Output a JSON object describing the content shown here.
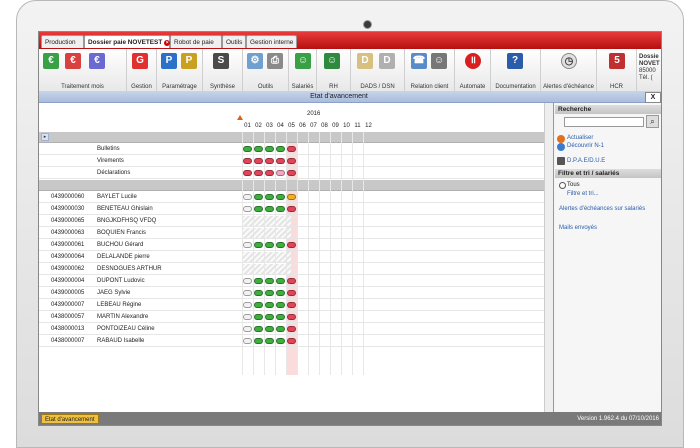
{
  "tabs": [
    {
      "label": "Production",
      "active": false,
      "closable": false
    },
    {
      "label": "Dossier paie NOVETEST",
      "active": true,
      "closable": true
    },
    {
      "label": "Robot de paie",
      "active": false,
      "closable": false
    },
    {
      "label": "Outils",
      "active": false,
      "closable": false
    },
    {
      "label": "Gestion interne",
      "active": false,
      "closable": false
    }
  ],
  "ribbon": {
    "groups": [
      {
        "label": "Traitement mois",
        "icon": "payroll-month-icon"
      },
      {
        "label": "Gestion",
        "icon": "g-management-icon"
      },
      {
        "label": "Paramétrage",
        "icon": "parameter-icon"
      },
      {
        "label": "Synthèse",
        "icon": "synthesis-icon"
      },
      {
        "label": "Outils",
        "icon": "tools-icon"
      },
      {
        "label": "Salariés",
        "icon": "employees-icon"
      },
      {
        "label": "RH",
        "icon": "hr-icon"
      },
      {
        "label": "DADS / DSN",
        "icon": "dads-dsn-icon"
      },
      {
        "label": "Relation client",
        "icon": "client-relation-icon"
      },
      {
        "label": "Automate",
        "icon": "pause-icon"
      },
      {
        "label": "Documentation",
        "icon": "question-icon"
      },
      {
        "label": "Alertes d'échéance",
        "icon": "clock-icon"
      },
      {
        "label": "HCR",
        "icon": "hcr-icon"
      }
    ],
    "dossier_lines": [
      "Dossie",
      "NOVET",
      "85000",
      "Tél. ("
    ]
  },
  "window_title": "Etat d'avancement",
  "close_label": "X",
  "grid": {
    "year": "2016",
    "months": [
      "01",
      "02",
      "03",
      "04",
      "05",
      "06",
      "07",
      "08",
      "09",
      "10",
      "11",
      "12"
    ],
    "current_month_index": 4,
    "rows": [
      {
        "type": "grey",
        "code": "",
        "name": "",
        "selector": "▸"
      },
      {
        "type": "item",
        "code": "",
        "name": "Bulletins",
        "status": [
          "g",
          "g",
          "g",
          "g",
          "r"
        ]
      },
      {
        "type": "item",
        "code": "",
        "name": "Virements",
        "status": [
          "r",
          "r",
          "r",
          "r",
          "r"
        ]
      },
      {
        "type": "item",
        "code": "",
        "name": "Déclarations",
        "status": [
          "r",
          "r",
          "r",
          "k",
          "r"
        ]
      },
      {
        "type": "grey",
        "code": "",
        "name": ""
      },
      {
        "type": "emp",
        "code": "0439000060",
        "name": "BAYLET Lucile",
        "status": [
          "e",
          "g",
          "g",
          "g",
          "o"
        ]
      },
      {
        "type": "emp",
        "code": "0439000030",
        "name": "BENETEAU Ghislain",
        "status": [
          "e",
          "g",
          "g",
          "g",
          "r"
        ]
      },
      {
        "type": "emp",
        "code": "0439000065",
        "name": "BNGJKDFHSQ VFDQ",
        "status": []
      },
      {
        "type": "emp",
        "code": "0439000063",
        "name": "BOQUIEN Francis",
        "status": []
      },
      {
        "type": "emp",
        "code": "0439000061",
        "name": "BUCHOU Gérard",
        "status": [
          "e",
          "g",
          "g",
          "g",
          "r"
        ]
      },
      {
        "type": "emp",
        "code": "0439000064",
        "name": "DELALANDE pierre",
        "status": []
      },
      {
        "type": "emp",
        "code": "0439000062",
        "name": "DESNOGUES ARTHUR",
        "status": []
      },
      {
        "type": "emp",
        "code": "0439000004",
        "name": "DUPONT Ludovic",
        "status": [
          "e",
          "g",
          "g",
          "g",
          "r"
        ]
      },
      {
        "type": "emp",
        "code": "0439000005",
        "name": "JAEG Sylvie",
        "status": [
          "e",
          "g",
          "g",
          "g",
          "r"
        ]
      },
      {
        "type": "emp",
        "code": "0439000007",
        "name": "LEBEAU Régine",
        "status": [
          "e",
          "g",
          "g",
          "g",
          "r"
        ]
      },
      {
        "type": "emp",
        "code": "0438000057",
        "name": "MARTIN Alexandre",
        "status": [
          "e",
          "g",
          "g",
          "g",
          "r"
        ]
      },
      {
        "type": "emp",
        "code": "0438000013",
        "name": "PONTOIZEAU Céline",
        "status": [
          "e",
          "g",
          "g",
          "g",
          "r"
        ]
      },
      {
        "type": "emp",
        "code": "0438000007",
        "name": "RABAUD Isabelle",
        "status": [
          "e",
          "g",
          "g",
          "g",
          "r"
        ]
      }
    ],
    "status_colors": {
      "g": "#3fae3f",
      "r": "#e0455a",
      "e": "#f2f2f2",
      "k": "#f4a6c0",
      "o": "#f0b020"
    }
  },
  "side": {
    "search_header": "Recherche",
    "links1": [
      {
        "label": "Actualiser",
        "icon": "refresh-icon"
      },
      {
        "label": "Découvrir N-1",
        "icon": "discover-icon"
      }
    ],
    "dpae_label": "D.P.A.E/D.U.E",
    "filter_header": "Filtre et tri / salariés",
    "filter_options": [
      "Tous",
      "Filtre et tri..."
    ],
    "links2": [
      "Alertes d'échéances sur salariés",
      "Mails envoyés"
    ]
  },
  "status_bar": {
    "tab_label": "Etat d'avancement",
    "version": "Version 1.962.4 du 07/10/2016"
  }
}
